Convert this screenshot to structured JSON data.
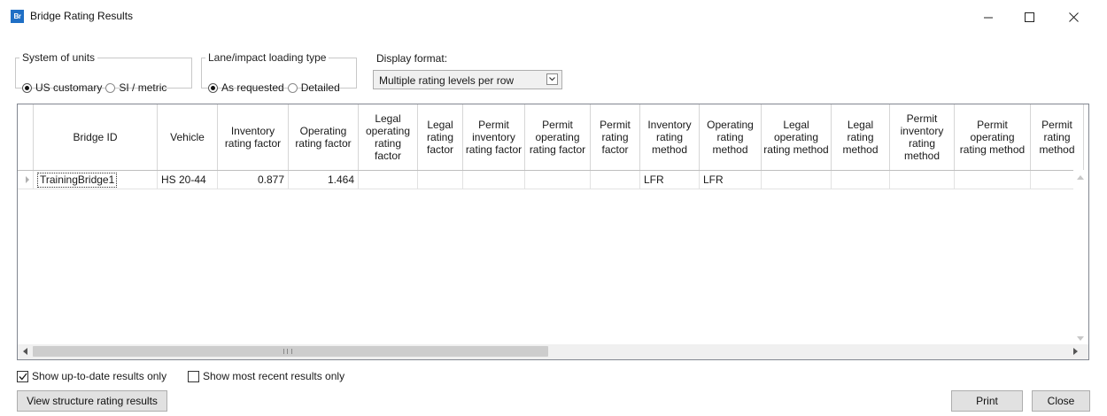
{
  "window": {
    "icon_text": "Br",
    "title": "Bridge Rating Results"
  },
  "units_group": {
    "legend": "System of units",
    "options": [
      "US customary",
      "SI / metric"
    ],
    "selected": "US customary"
  },
  "lane_group": {
    "legend": "Lane/impact loading type",
    "options": [
      "As requested",
      "Detailed"
    ],
    "selected": "As requested"
  },
  "display_format": {
    "label": "Display format:",
    "value": "Multiple rating levels per row"
  },
  "grid": {
    "columns": [
      "Bridge ID",
      "Vehicle",
      "Inventory rating factor",
      "Operating rating factor",
      "Legal operating rating factor",
      "Legal rating factor",
      "Permit inventory rating factor",
      "Permit operating rating factor",
      "Permit rating factor",
      "Inventory rating method",
      "Operating rating method",
      "Legal operating rating method",
      "Legal rating method",
      "Permit inventory rating method",
      "Permit operating rating method",
      "Permit rating method"
    ],
    "rows": [
      [
        "TrainingBridge1",
        "HS 20-44",
        "0.877",
        "1.464",
        "",
        "",
        "",
        "",
        "",
        "LFR",
        "LFR",
        "",
        "",
        "",
        "",
        ""
      ]
    ]
  },
  "options": {
    "up_to_date_label": "Show up-to-date results only",
    "up_to_date_checked": true,
    "most_recent_label": "Show most recent results only",
    "most_recent_checked": false
  },
  "buttons": {
    "view_structure": "View structure rating results",
    "print": "Print",
    "close": "Close"
  },
  "colors": {
    "app_icon": "#1f6fc5",
    "grid_border": "#828790",
    "button_face": "#e1e1e1"
  }
}
